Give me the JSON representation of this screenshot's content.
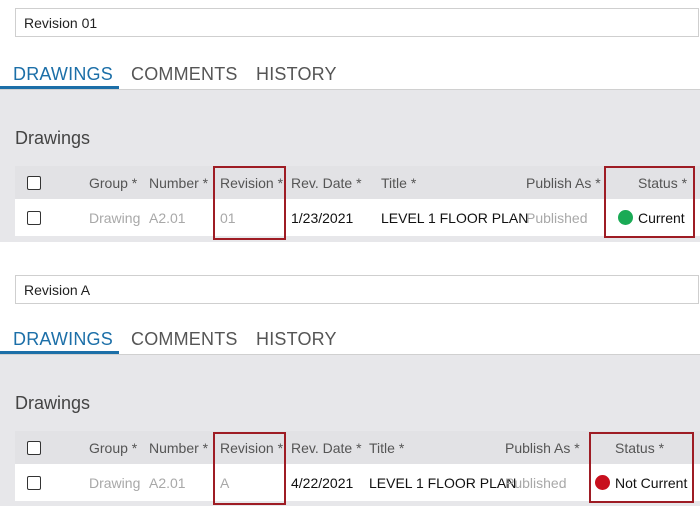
{
  "panels": [
    {
      "revision_input_value": "Revision 01",
      "tabs": [
        {
          "label": "DRAWINGS",
          "active": true
        },
        {
          "label": "COMMENTS",
          "active": false
        },
        {
          "label": "HISTORY",
          "active": false
        }
      ],
      "section_title": "Drawings",
      "columns": {
        "group": "Group *",
        "number": "Number *",
        "revision": "Revision *",
        "rev_date": "Rev. Date *",
        "title": "Title *",
        "publish_as": "Publish As *",
        "status": "Status *"
      },
      "row": {
        "group": "Drawing",
        "number": "A2.01",
        "revision": "01",
        "rev_date": "1/23/2021",
        "title": "LEVEL 1 FLOOR PLAN",
        "publish_as": "Published",
        "status": "Current",
        "status_color": "#1aaa55"
      }
    },
    {
      "revision_input_value": "Revision A",
      "tabs": [
        {
          "label": "DRAWINGS",
          "active": true
        },
        {
          "label": "COMMENTS",
          "active": false
        },
        {
          "label": "HISTORY",
          "active": false
        }
      ],
      "section_title": "Drawings",
      "columns": {
        "group": "Group *",
        "number": "Number *",
        "revision": "Revision *",
        "rev_date": "Rev. Date *",
        "title": "Title *",
        "publish_as": "Publish As *",
        "status": "Status *"
      },
      "row": {
        "group": "Drawing",
        "number": "A2.01",
        "revision": "A",
        "rev_date": "4/22/2021",
        "title": "LEVEL 1 FLOOR PLAN",
        "publish_as": "Published",
        "status": "Not Current",
        "status_color": "#c8101e"
      }
    }
  ],
  "colors": {
    "accent": "#1c6fa8",
    "highlight_border": "#9e1c24",
    "content_background": "#e7e7ea"
  }
}
